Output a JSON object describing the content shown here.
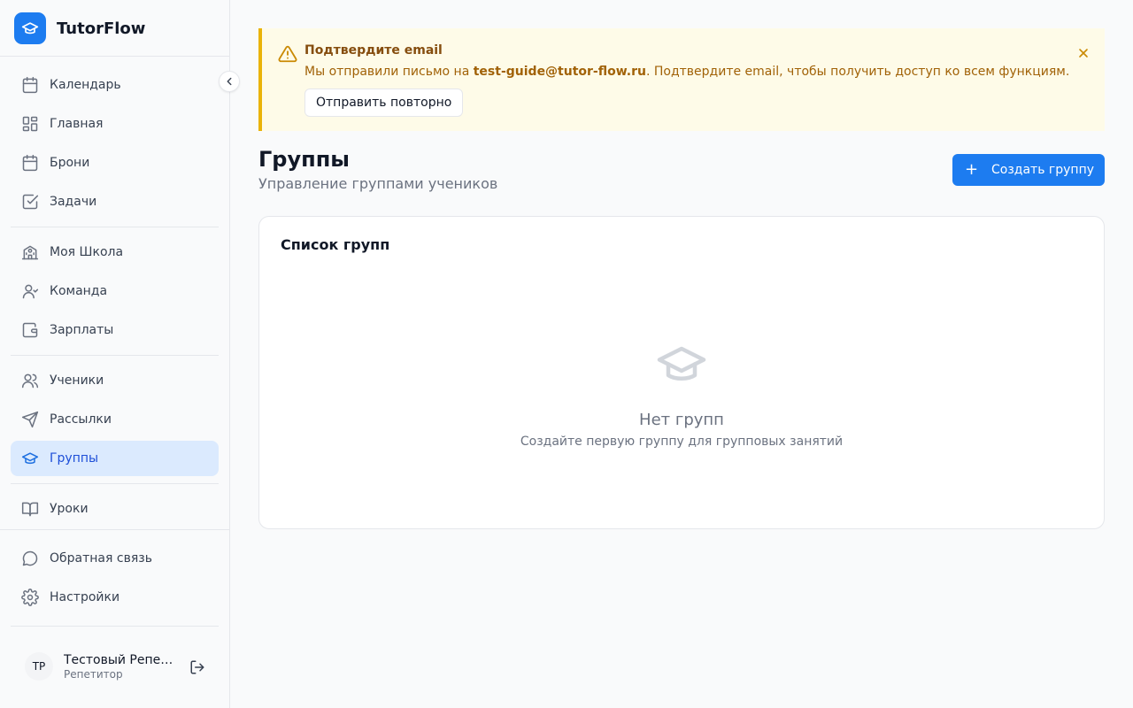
{
  "app": {
    "name": "TutorFlow",
    "brand_color": "#1d7cf0"
  },
  "sidebar": {
    "items": [
      {
        "label": "Календарь",
        "icon": "calendar-icon"
      },
      {
        "label": "Главная",
        "icon": "dashboard-icon"
      },
      {
        "label": "Брони",
        "icon": "calendar-icon"
      },
      {
        "label": "Задачи",
        "icon": "checkbox-icon"
      },
      {
        "label": "Моя Школа",
        "icon": "school-icon"
      },
      {
        "label": "Команда",
        "icon": "user-icon"
      },
      {
        "label": "Зарплаты",
        "icon": "wallet-icon"
      },
      {
        "label": "Ученики",
        "icon": "users-icon"
      },
      {
        "label": "Рассылки",
        "icon": "send-icon"
      },
      {
        "label": "Группы",
        "icon": "graduation-cap-icon",
        "active": true
      },
      {
        "label": "Уроки",
        "icon": "book-icon"
      },
      {
        "label": "Обратная связь",
        "icon": "message-icon"
      },
      {
        "label": "Настройки",
        "icon": "gear-icon"
      }
    ]
  },
  "user": {
    "initials": "ТР",
    "name": "Тестовый Репетитор",
    "role": "Репетитор"
  },
  "banner": {
    "title": "Подтвердите email",
    "text_before": "Мы отправили письмо на ",
    "email": "test-guide@tutor-flow.ru",
    "text_after": ". Подтвердите email, чтобы получить доступ ко всем функциям.",
    "resend_label": "Отправить повторно",
    "accent_color": "#eab308"
  },
  "page": {
    "title": "Группы",
    "subtitle": "Управление группами учеников",
    "create_label": "Создать группу"
  },
  "card": {
    "title": "Список групп",
    "empty_title": "Нет групп",
    "empty_subtitle": "Создайте первую группу для групповых занятий"
  }
}
